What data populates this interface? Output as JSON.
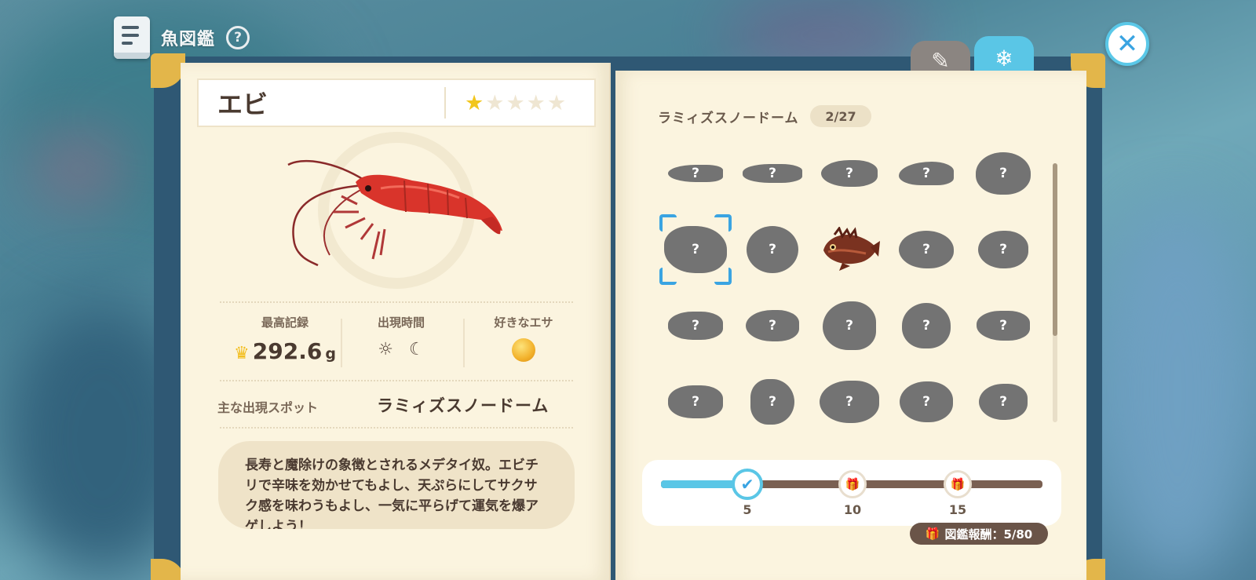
{
  "header": {
    "title": "魚図鑑",
    "help_label": "?"
  },
  "close_label": "✕",
  "tabs": [
    {
      "icon": "brush-icon",
      "glyph": "✎"
    },
    {
      "icon": "snowflake-icon",
      "glyph": "❄"
    }
  ],
  "fish": {
    "name": "エビ",
    "rarity": 1,
    "rarity_max": 5,
    "record_label": "最高記録",
    "record_value": "292.6",
    "record_unit": "g",
    "time_label": "出現時間",
    "bait_label": "好きなエサ",
    "spot_label": "主な出現スポット",
    "spot_value": "ラミィズスノードーム",
    "description": "長寿と魔除けの象徴とされるメデタイ奴。エビチリで辛味を効かせてもよし、天ぷらにしてサクサク感を味わうもよし、一気に平らげて運気を爆アゲしよう！"
  },
  "collection": {
    "location": "ラミィズスノードーム",
    "count": "2/27",
    "grid_mark": "?"
  },
  "progress": {
    "value": 5,
    "max": 15,
    "milestones": [
      "5",
      "10",
      "15"
    ],
    "reward_label": "図鑑報酬：5/80"
  },
  "colors": {
    "accent": "#5ac6e6",
    "page": "#fbf4df",
    "ink": "#4a3a30",
    "star": "#f2c61d",
    "frame": "#2f5874",
    "corner": "#e3b64a"
  }
}
